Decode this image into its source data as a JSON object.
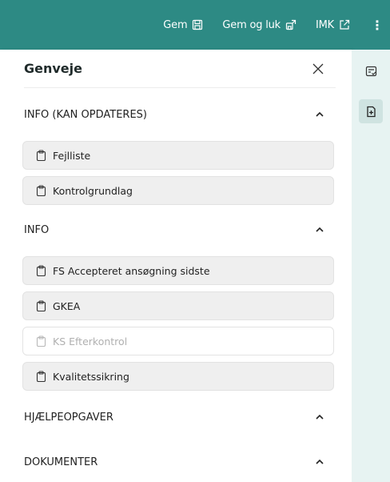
{
  "topbar": {
    "save_label": "Gem",
    "save_close_label": "Gem og luk",
    "imk_label": "IMK",
    "color": "#2d8a84"
  },
  "panel": {
    "title": "Genveje"
  },
  "sections": [
    {
      "title": "INFO (KAN OPDATERES)",
      "expanded": true,
      "items": [
        {
          "label": "Fejlliste",
          "disabled": false
        },
        {
          "label": "Kontrolgrundlag",
          "disabled": false
        }
      ]
    },
    {
      "title": "INFO",
      "expanded": true,
      "items": [
        {
          "label": "FS Accepteret ansøgning sidste",
          "disabled": false
        },
        {
          "label": "GKEA",
          "disabled": false
        },
        {
          "label": "KS Efterkontrol",
          "disabled": true
        },
        {
          "label": "Kvalitetssikring",
          "disabled": false
        }
      ]
    },
    {
      "title": "HJÆLPEOPGAVER",
      "expanded": true,
      "items": []
    },
    {
      "title": "DOKUMENTER",
      "expanded": true,
      "items": []
    }
  ],
  "rail": {
    "items": [
      {
        "icon": "checklist-icon",
        "active": false
      },
      {
        "icon": "add-document-icon",
        "active": true
      }
    ]
  }
}
